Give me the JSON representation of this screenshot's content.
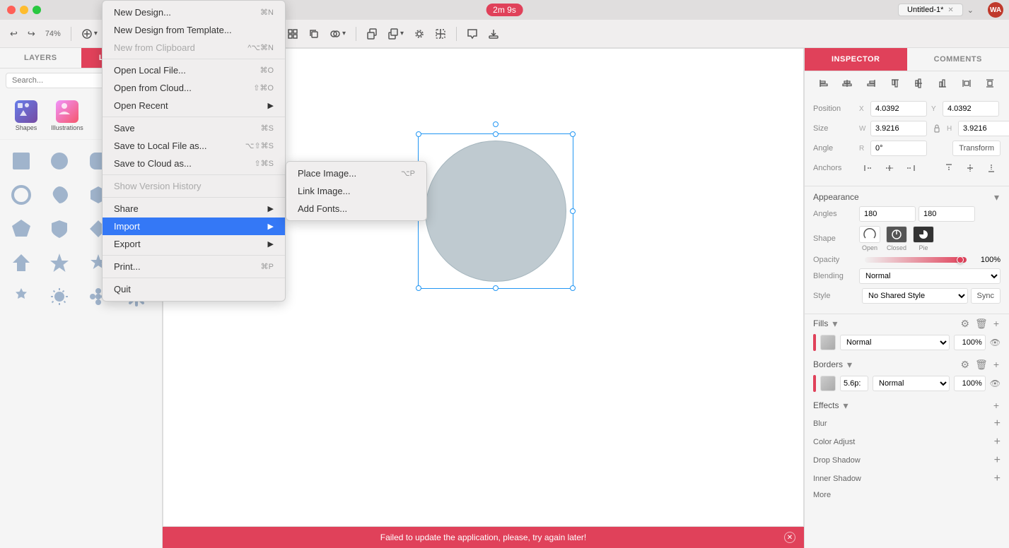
{
  "titlebar": {
    "timer": "2m 9s",
    "tab_title": "Untitled-1*",
    "user_initials": "WA"
  },
  "toolbar": {
    "undo_label": "↩",
    "redo_label": "↪",
    "zoom_level": "74%",
    "buttons": [
      "insert",
      "pencil",
      "text",
      "image",
      "boolean",
      "flip",
      "rotate_cw",
      "rotate_ccw",
      "grid",
      "duplicate",
      "combine",
      "mask",
      "slice",
      "artboard",
      "export"
    ]
  },
  "left_panel": {
    "tabs": [
      "LAYERS",
      "LIBRARIES"
    ],
    "active_tab": "LIBRARIES",
    "search_placeholder": "Search...",
    "library_items": [
      {
        "name": "Shapes",
        "type": "shapes"
      },
      {
        "name": "Illustrations",
        "type": "illustrations"
      }
    ]
  },
  "canvas": {
    "status_message": "Failed to update the application, please, try again later!"
  },
  "context_menu": {
    "items": [
      {
        "label": "New Design...",
        "shortcut": "⌘N",
        "has_sub": false,
        "disabled": false
      },
      {
        "label": "New Design from Template...",
        "shortcut": "",
        "has_sub": false,
        "disabled": false
      },
      {
        "label": "New from Clipboard",
        "shortcut": "^⌥⌘N",
        "has_sub": false,
        "disabled": false
      },
      {
        "separator": true
      },
      {
        "label": "Open Local File...",
        "shortcut": "⌘O",
        "has_sub": false,
        "disabled": false
      },
      {
        "label": "Open from Cloud...",
        "shortcut": "⇧⌘O",
        "has_sub": false,
        "disabled": false
      },
      {
        "label": "Open Recent",
        "shortcut": "",
        "has_sub": true,
        "disabled": false
      },
      {
        "separator": true
      },
      {
        "label": "Save",
        "shortcut": "⌘S",
        "has_sub": false,
        "disabled": false
      },
      {
        "label": "Save to Local File as...",
        "shortcut": "⌥⇧⌘S",
        "has_sub": false,
        "disabled": false
      },
      {
        "label": "Save to Cloud as...",
        "shortcut": "⇧⌘S",
        "has_sub": false,
        "disabled": false
      },
      {
        "separator": true
      },
      {
        "label": "Show Version History",
        "shortcut": "",
        "has_sub": false,
        "disabled": true
      },
      {
        "separator": true
      },
      {
        "label": "Share",
        "shortcut": "",
        "has_sub": true,
        "disabled": false
      },
      {
        "label": "Import",
        "shortcut": "",
        "has_sub": true,
        "disabled": false,
        "active": true
      },
      {
        "label": "Export",
        "shortcut": "",
        "has_sub": true,
        "disabled": false
      },
      {
        "separator": true
      },
      {
        "label": "Print...",
        "shortcut": "⌘P",
        "has_sub": false,
        "disabled": false
      },
      {
        "separator": true
      },
      {
        "label": "Quit",
        "shortcut": "",
        "has_sub": false,
        "disabled": false
      }
    ]
  },
  "submenu": {
    "items": [
      {
        "label": "Place Image...",
        "shortcut": "⌥P"
      },
      {
        "label": "Link Image...",
        "shortcut": ""
      },
      {
        "label": "Add Fonts...",
        "shortcut": ""
      }
    ]
  },
  "inspector": {
    "tabs": [
      "INSPECTOR",
      "COMMENTS"
    ],
    "active_tab": "INSPECTOR",
    "position": {
      "x": "4.0392",
      "y": "4.0392"
    },
    "size": {
      "w": "3.9216",
      "h": "3.9216"
    },
    "angle": {
      "r": "0°"
    },
    "transform_btn": "Transform",
    "appearance": {
      "angles": {
        "left": "180",
        "right": "180"
      },
      "shape_options": [
        "Open",
        "Closed",
        "Pie"
      ]
    },
    "opacity": {
      "value": "100%"
    },
    "blending": {
      "value": "Normal"
    },
    "style": {
      "value": "No Shared Style",
      "sync_btn": "Sync"
    },
    "fills": {
      "label": "Fills",
      "mode": "Normal",
      "opacity": "100%"
    },
    "borders": {
      "label": "Borders",
      "size": "5.6p:",
      "mode": "Normal",
      "opacity": "100%"
    },
    "effects": {
      "label": "Effects",
      "items": [
        {
          "label": "Blur"
        },
        {
          "label": "Color Adjust"
        },
        {
          "label": "Drop Shadow"
        },
        {
          "label": "Inner Shadow"
        },
        {
          "label": "More"
        }
      ]
    }
  }
}
